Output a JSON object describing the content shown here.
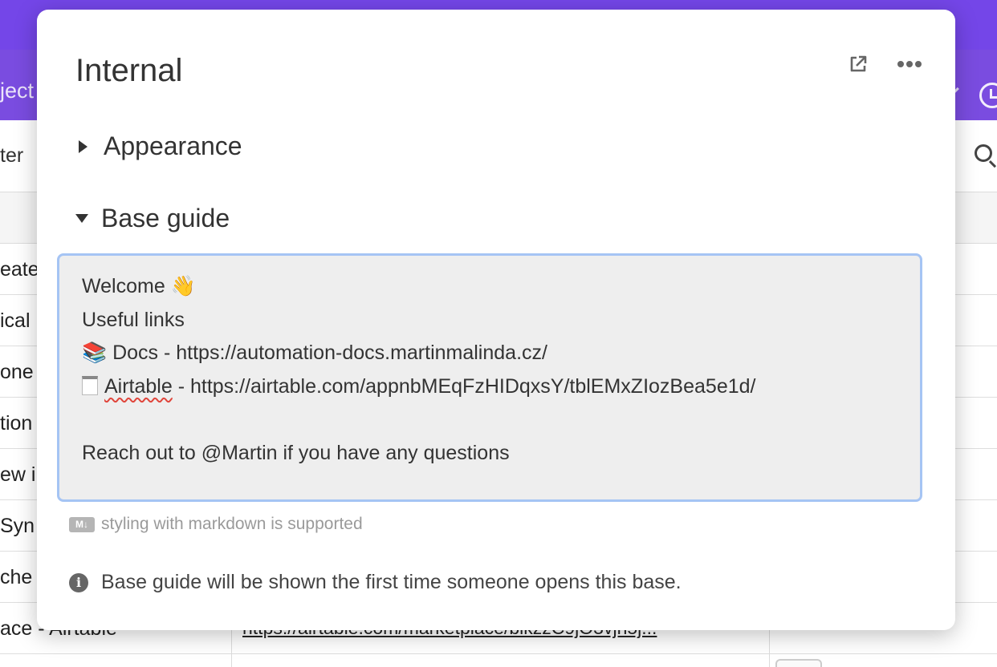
{
  "background": {
    "tab_partial": "ject",
    "toolbar_partial": "ter",
    "rows": [
      {
        "text": "eate",
        "link": ""
      },
      {
        "text": "ical",
        "link": ""
      },
      {
        "text": "one",
        "link": ""
      },
      {
        "text": "tion",
        "link": ""
      },
      {
        "text": "ew i",
        "link": ""
      },
      {
        "text": "Syn",
        "link": ""
      },
      {
        "text": "che",
        "link": ""
      },
      {
        "text": "ace - Airtable",
        "link": "https://airtable.com/marketplace/blkzzC9jO3vjh5j..."
      }
    ],
    "colors": {
      "header": "#7a4ce0",
      "header_top": "#7446e8"
    }
  },
  "modal": {
    "title": "Internal",
    "icons": {
      "open": "open-external-icon",
      "more": "more-options-icon"
    },
    "sections": {
      "appearance": "Appearance",
      "base_guide": "Base guide"
    },
    "guide": {
      "welcome": "Welcome 👋",
      "useful_links": "Useful links",
      "docs_emoji": "📚",
      "docs_line": " Docs - https://automation-docs.martinmalinda.cz/",
      "airtable_word": "Airtable",
      "airtable_rest": " - https://airtable.com/appnbMEqFzHIDqxsY/tblEMxZIozBea5e1d/",
      "blank": "",
      "reach_out": "Reach out to @Martin if you have any questions"
    },
    "markdown_badge": "M↓",
    "markdown_hint": "styling with markdown is supported",
    "info_glyph": "i",
    "info_text": "Base guide will be shown the first time someone opens this base.",
    "colors": {
      "focus_border": "#a5c4f4",
      "guide_bg": "#eeeeee"
    }
  }
}
